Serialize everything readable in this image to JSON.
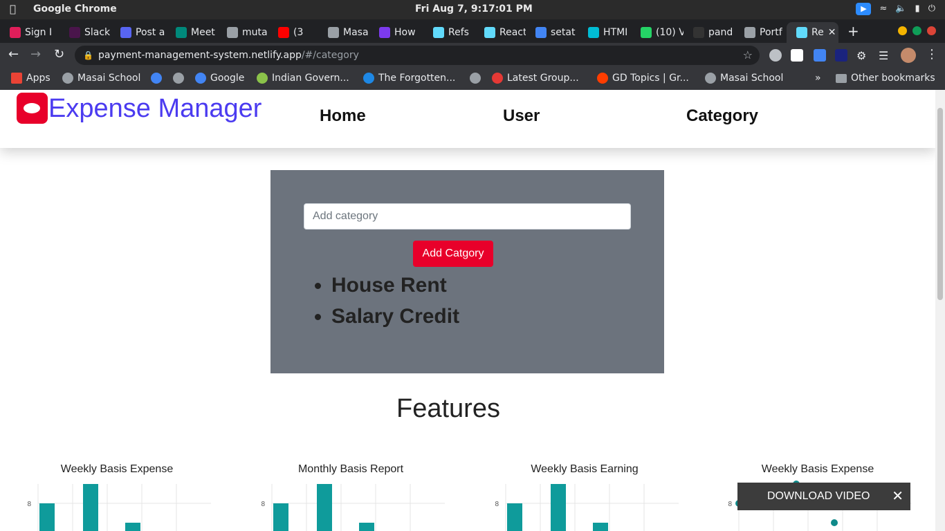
{
  "os": {
    "app_name": "Google Chrome",
    "clock": "Fri Aug  7,  9:17:01 PM"
  },
  "tabs": [
    {
      "label": "Sign I",
      "color": "#e01e5a"
    },
    {
      "label": "Slack",
      "color": "#4a154b"
    },
    {
      "label": "Post a",
      "color": "#5865f2"
    },
    {
      "label": "Meet",
      "color": "#00897b"
    },
    {
      "label": "muta",
      "color": "#9aa0a6"
    },
    {
      "label": "(3",
      "color": "#ff0000"
    },
    {
      "label": "Masa",
      "color": "#9aa0a6"
    },
    {
      "label": "How",
      "color": "#7c3aed"
    },
    {
      "label": "Refs",
      "color": "#61dafb"
    },
    {
      "label": "React",
      "color": "#61dafb"
    },
    {
      "label": "setat",
      "color": "#4285f4"
    },
    {
      "label": "HTMI",
      "color": "#00bcd4"
    },
    {
      "label": "(10) V",
      "color": "#25d366"
    },
    {
      "label": "pand",
      "color": "#333333"
    },
    {
      "label": "Portf",
      "color": "#9aa0a6"
    },
    {
      "label": "Re",
      "color": "#61dafb"
    }
  ],
  "toolbar": {
    "url_host": "payment-management-system.netlify.app",
    "url_path": "/#/category"
  },
  "bookmarks": [
    {
      "label": "Apps"
    },
    {
      "label": "Masai School"
    },
    {
      "label": ""
    },
    {
      "label": ""
    },
    {
      "label": "Google"
    },
    {
      "label": "Indian Govern..."
    },
    {
      "label": "The Forgotten..."
    },
    {
      "label": ""
    },
    {
      "label": "Latest Group..."
    },
    {
      "label": "GD Topics | Gr..."
    },
    {
      "label": "Masai School"
    }
  ],
  "bookmarks_overflow": "»",
  "other_bookmarks": "Other bookmarks",
  "site": {
    "brand": "Expense Manager",
    "nav": {
      "home": "Home",
      "user": "User",
      "category": "Category"
    },
    "input_placeholder": "Add category",
    "add_button": "Add Catgory",
    "categories": [
      "House Rent",
      "Salary Credit"
    ],
    "features_heading": "Features",
    "download_video": "DOWNLOAD VIDEO"
  },
  "chart_data": [
    {
      "type": "bar",
      "title": "Weekly Basis Expense",
      "ytick": "8",
      "values": [
        8,
        9,
        7
      ],
      "color": "#0f9b9b"
    },
    {
      "type": "bar",
      "title": "Monthly Basis Report",
      "ytick": "8",
      "values": [
        8,
        9,
        7
      ],
      "color": "#0f9b9b"
    },
    {
      "type": "bar",
      "title": "Weekly Basis Earning",
      "ytick": "8",
      "values": [
        8,
        9,
        7
      ],
      "color": "#0f9b9b"
    },
    {
      "type": "scatter",
      "title": "Weekly Basis Expense",
      "ytick": "8",
      "values": [
        8,
        9,
        7
      ],
      "color": "#0f8a8a"
    }
  ]
}
